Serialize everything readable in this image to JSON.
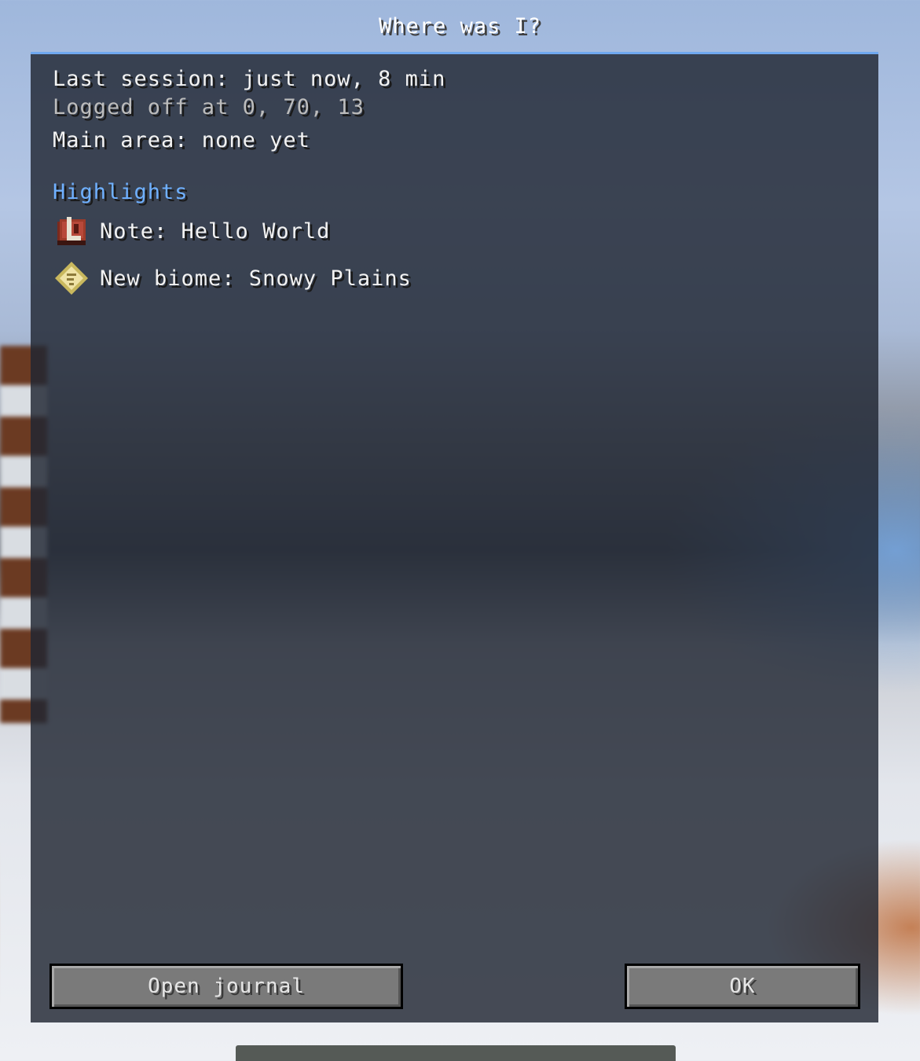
{
  "window": {
    "title": "Where was I?"
  },
  "session": {
    "last_session": "Last session: just now, 8 min",
    "logged_off": "Logged off at 0, 70, 13",
    "main_area": "Main area: none yet"
  },
  "highlights": {
    "heading": "Highlights",
    "items": [
      {
        "icon": "note-book-icon",
        "text": "Note: Hello World"
      },
      {
        "icon": "map-scroll-icon",
        "text": "New biome: Snowy Plains"
      }
    ]
  },
  "buttons": {
    "open_journal": "Open journal",
    "ok": "OK"
  },
  "colors": {
    "accent": "#6fb0ff",
    "panel_border": "#6fa8f0",
    "muted_text": "#bcbcbc"
  }
}
